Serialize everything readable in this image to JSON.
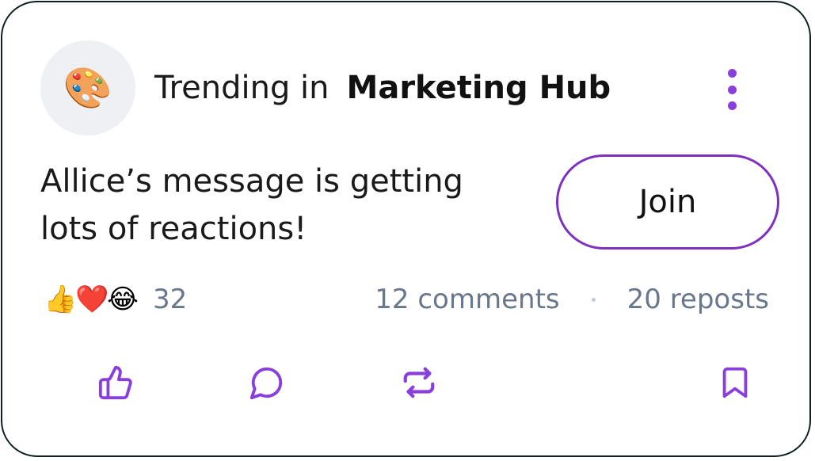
{
  "header": {
    "avatar_emoji": "🎨",
    "trending_prefix": "Trending in",
    "community_name": "Marketing Hub"
  },
  "post": {
    "message": "Allice’s message is getting lots of reactions!",
    "join_label": "Join"
  },
  "reactions": {
    "emojis": [
      "👍",
      "❤️",
      "😂"
    ],
    "count": "32"
  },
  "stats": {
    "comments": "12 comments",
    "reposts": "20 reposts"
  },
  "actions": {
    "icons": [
      "thumbs-up-icon",
      "comment-icon",
      "repost-icon",
      "bookmark-icon"
    ]
  },
  "colors": {
    "accent": "#8a3fdc",
    "join_border": "#7e30bf",
    "muted_text": "#69778c",
    "card_border": "#0f1f22"
  }
}
